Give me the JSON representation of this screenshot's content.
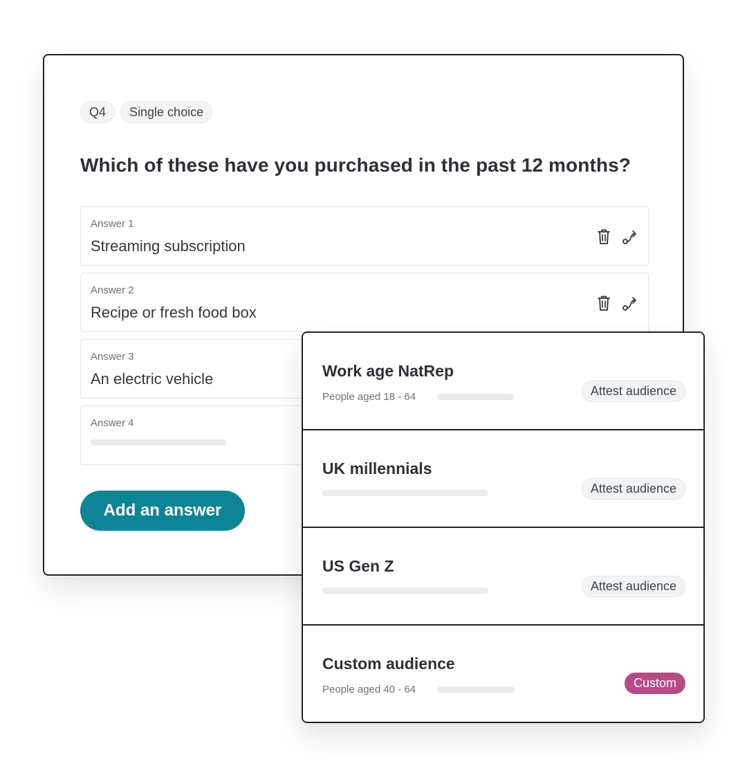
{
  "question": {
    "tags": [
      "Q4",
      "Single choice"
    ],
    "title": "Which of these have you purchased in the past 12 months?",
    "answers": [
      {
        "label": "Answer 1",
        "value": "Streaming subscription"
      },
      {
        "label": "Answer 2",
        "value": "Recipe or fresh food box"
      },
      {
        "label": "Answer 3",
        "value": "An electric vehicle"
      },
      {
        "label": "Answer 4",
        "value": ""
      }
    ],
    "add_answer_label": "Add an answer"
  },
  "audiences": [
    {
      "name": "Work age NatRep",
      "sub": "People aged 18 - 64",
      "badge": "Attest audience"
    },
    {
      "name": "UK millennials",
      "sub": "",
      "badge": "Attest audience"
    },
    {
      "name": "US Gen Z",
      "sub": "",
      "badge": "Attest audience"
    },
    {
      "name": "Custom audience",
      "sub": "People aged 40 - 64",
      "badge": "Custom"
    }
  ],
  "icons": {
    "delete": "trash-icon",
    "route": "route-icon"
  },
  "colors": {
    "primary_button": "#0e8497",
    "custom_badge": "#b84a84",
    "card_border": "#1f2124"
  }
}
